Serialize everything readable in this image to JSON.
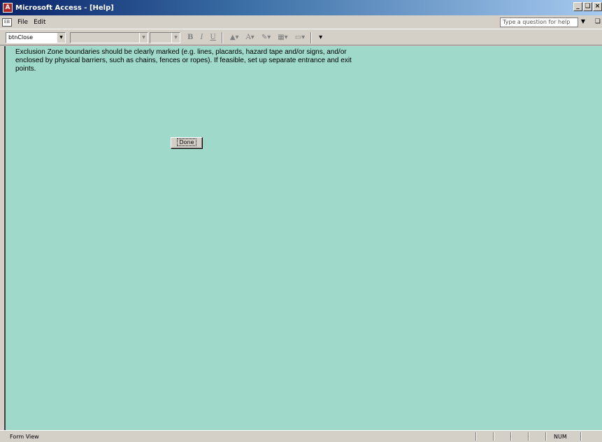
{
  "window": {
    "title": "Microsoft Access - [Help]",
    "controls": [
      "_",
      "ð",
      "×"
    ]
  },
  "menubar": {
    "items": [
      {
        "label": "File"
      },
      {
        "label": "Edit"
      }
    ],
    "help_placeholder": "Type a question for help"
  },
  "toolbar": {
    "object_combo": "btnClose",
    "bold_label": "B",
    "italic_label": "I",
    "underline_label": "U"
  },
  "form": {
    "help_text": "Exclusion Zone boundaries should be clearly marked (e.g. lines, placards, hazard tape and/or signs, and/or enclosed by physical barriers, such as chains, fences or ropes).  If feasible, set up separate entrance and exit points.",
    "done_label": "Done",
    "background": "#9fd9c9"
  },
  "statusbar": {
    "mode": "Form View",
    "num": "NUM"
  }
}
